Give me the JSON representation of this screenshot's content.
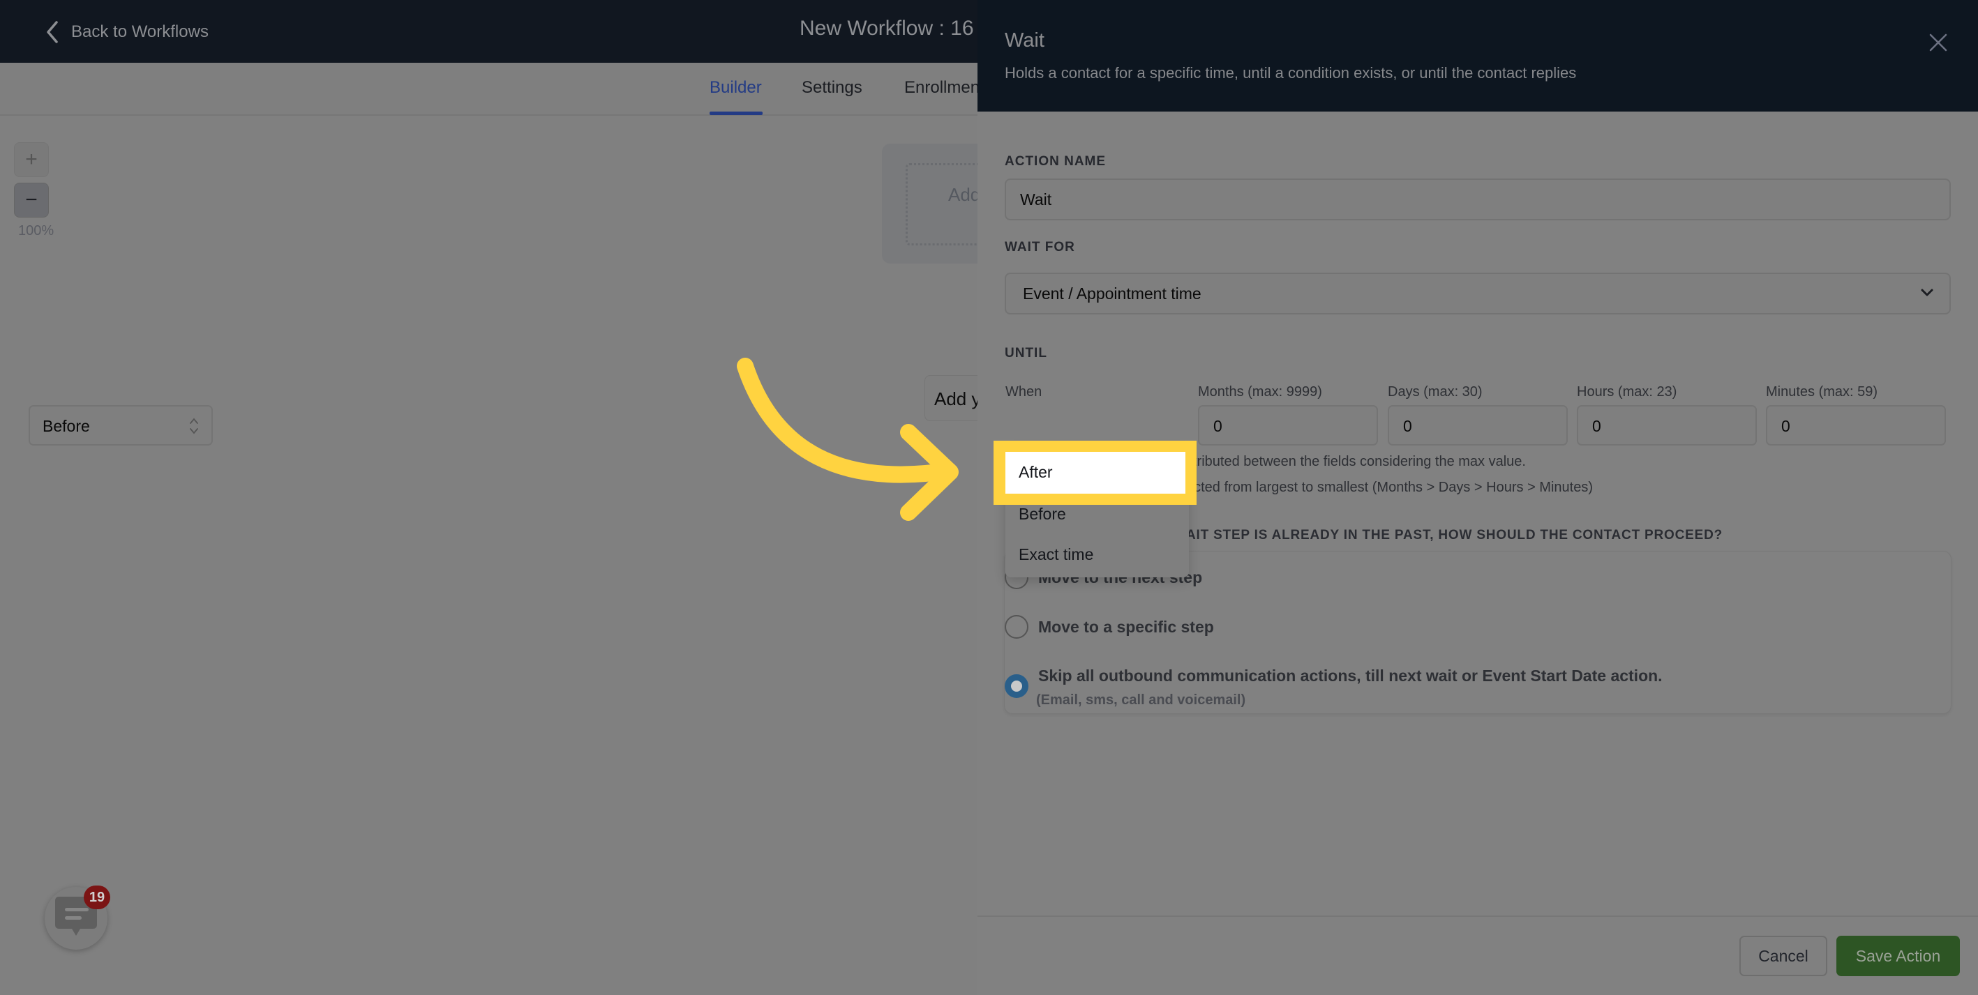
{
  "topbar": {
    "back_label": "Back to Workflows",
    "workflow_title": "New Workflow : 16"
  },
  "tabs": [
    {
      "label": "Builder",
      "active": true
    },
    {
      "label": "Settings",
      "active": false
    },
    {
      "label": "Enrollmen",
      "active": false
    }
  ],
  "canvas": {
    "zoom_in": "+",
    "zoom_out": "−",
    "zoom_level": "100%",
    "trigger_placeholder": "Add",
    "add_node_label": "Add y"
  },
  "chat": {
    "badge_count": "19"
  },
  "panel": {
    "title": "Wait",
    "subtitle": "Holds a contact for a specific time, until a condition exists, or until the contact replies",
    "action_name_label": "ACTION NAME",
    "action_name_value": "Wait",
    "wait_for_label": "WAIT FOR",
    "wait_for_value": "Event / Appointment time",
    "until_label": "UNTIL",
    "when_label": "When",
    "when_value": "Before",
    "months_label": "Months (max: 9999)",
    "months_value": "0",
    "days_label": "Days (max: 30)",
    "days_value": "0",
    "hours_label": "Hours (max: 23)",
    "hours_value": "0",
    "minutes_label": "Minutes (max: 59)",
    "minutes_value": "0",
    "hint_1": "stributed between the fields considering the max value.",
    "hint_2": "acted from largest to smallest (Months > Days > Hours > Minutes)",
    "past_question": "AIT STEP IS ALREADY IN THE PAST, HOW SHOULD THE CONTACT PROCEED?",
    "radio_options": [
      {
        "label": "Move to the next step",
        "checked": false
      },
      {
        "label": "Move to a specific step",
        "checked": false
      },
      {
        "label": "Skip all outbound communication actions, till next wait or Event Start Date action.",
        "sublabel": "(Email, sms, call and voicemail)",
        "checked": true
      }
    ],
    "cancel_label": "Cancel",
    "save_label": "Save Action"
  },
  "dropdown": {
    "options": [
      "After",
      "Before",
      "Exact time"
    ],
    "highlighted": "After"
  },
  "colors": {
    "accent_blue": "#233b85",
    "save_green": "#2d5524",
    "highlight_yellow": "#ffd340",
    "radio_checked": "#2a5f8a",
    "badge_red": "#7b1414"
  }
}
